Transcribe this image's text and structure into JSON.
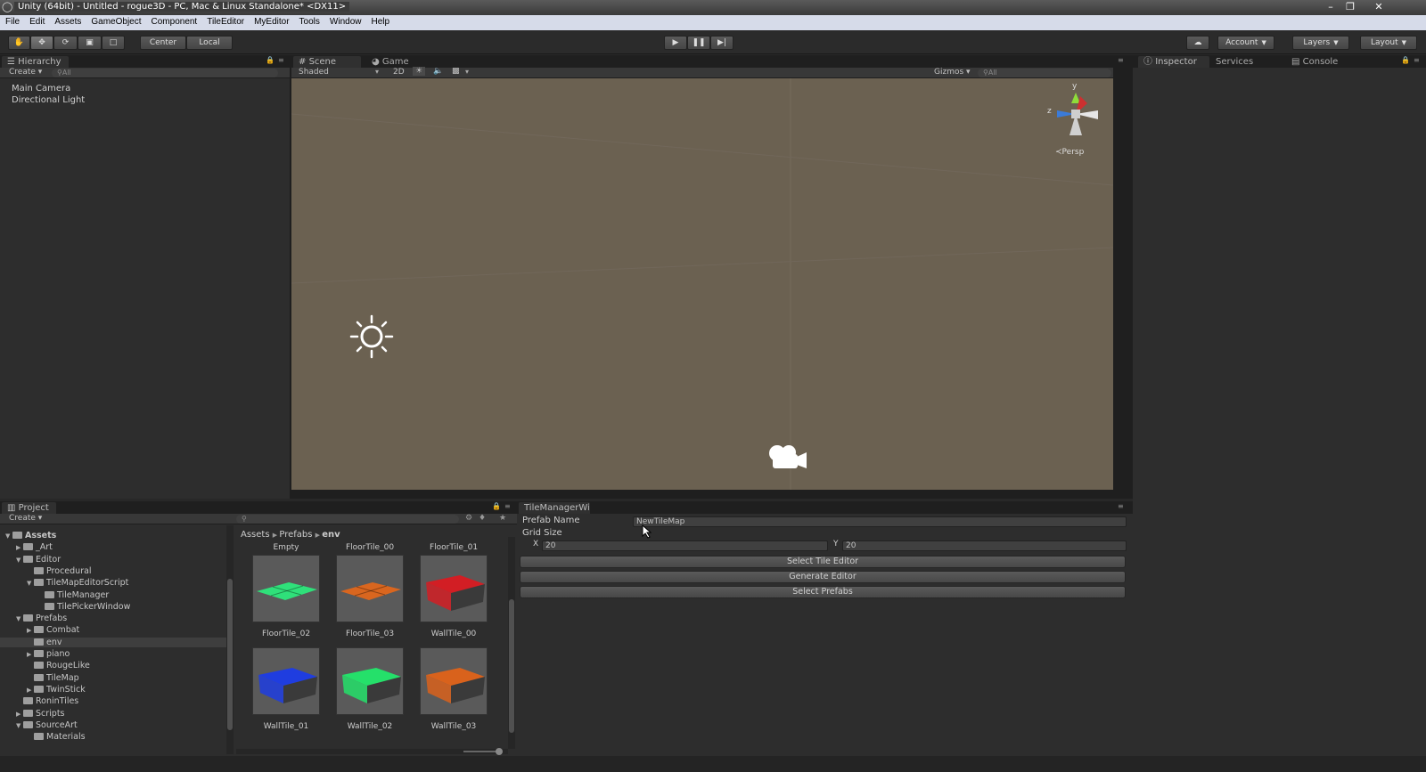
{
  "titlebar": {
    "title": "Unity (64bit) - Untitled - rogue3D - PC, Mac & Linux Standalone* <DX11>",
    "minimize": "–",
    "restore": "❐",
    "close": "✕"
  },
  "menubar": [
    "File",
    "Edit",
    "Assets",
    "GameObject",
    "Component",
    "TileEditor",
    "MyEditor",
    "Tools",
    "Window",
    "Help"
  ],
  "toolbar": {
    "pivot_center": "Center",
    "pivot_local": "Local",
    "account": "Account",
    "layers": "Layers",
    "layout": "Layout"
  },
  "hierarchy": {
    "tab": "Hierarchy",
    "create": "Create",
    "search_placeholder": "All",
    "items": [
      "Main Camera",
      "Directional Light"
    ]
  },
  "scene": {
    "tab_scene": "Scene",
    "tab_game": "Game",
    "shading": "Shaded",
    "mode_2d": "2D",
    "gizmos": "Gizmos",
    "search_placeholder": "All",
    "persp": "Persp",
    "axis_y": "y",
    "axis_z": "z"
  },
  "inspector": {
    "tab_inspector": "Inspector",
    "tab_services": "Services",
    "tab_console": "Console"
  },
  "project": {
    "tab": "Project",
    "create": "Create",
    "breadcrumb": [
      "Assets",
      "Prefabs",
      "env"
    ],
    "tree": [
      {
        "label": "Assets",
        "depth": 0,
        "open": true,
        "bold": true
      },
      {
        "label": "_Art",
        "depth": 1,
        "open": false
      },
      {
        "label": "Editor",
        "depth": 1,
        "open": true
      },
      {
        "label": "Procedural",
        "depth": 2,
        "open": null
      },
      {
        "label": "TileMapEditorScript",
        "depth": 2,
        "open": true
      },
      {
        "label": "TileManager",
        "depth": 3,
        "open": null
      },
      {
        "label": "TilePickerWindow",
        "depth": 3,
        "open": null
      },
      {
        "label": "Prefabs",
        "depth": 1,
        "open": true
      },
      {
        "label": "Combat",
        "depth": 2,
        "open": false
      },
      {
        "label": "env",
        "depth": 2,
        "open": null,
        "selected": true
      },
      {
        "label": "piano",
        "depth": 2,
        "open": false
      },
      {
        "label": "RougeLike",
        "depth": 2,
        "open": null
      },
      {
        "label": "TileMap",
        "depth": 2,
        "open": null
      },
      {
        "label": "TwinStick",
        "depth": 2,
        "open": false
      },
      {
        "label": "RoninTiles",
        "depth": 1,
        "open": null
      },
      {
        "label": "Scripts",
        "depth": 1,
        "open": false
      },
      {
        "label": "SourceArt",
        "depth": 1,
        "open": true
      },
      {
        "label": "Materials",
        "depth": 2,
        "open": null
      }
    ],
    "top_labels": [
      "Empty",
      "FloorTile_00",
      "FloorTile_01"
    ],
    "assets": [
      {
        "name": "FloorTile_02",
        "color": "#2fe07a",
        "kind": "floor"
      },
      {
        "name": "FloorTile_03",
        "color": "#d9661f",
        "kind": "floor"
      },
      {
        "name": "WallTile_00",
        "color": "#d21e24",
        "kind": "wall"
      },
      {
        "name": "WallTile_01",
        "color": "#1f3de0",
        "kind": "wall"
      },
      {
        "name": "WallTile_02",
        "color": "#25e06a",
        "kind": "wall"
      },
      {
        "name": "WallTile_03",
        "color": "#d9621c",
        "kind": "wall"
      }
    ]
  },
  "tilemanager": {
    "tab": "TileManagerWi",
    "prefab_name_label": "Prefab Name",
    "prefab_name_value": "NewTileMap",
    "grid_size_label": "Grid Size",
    "x_label": "X",
    "x_value": "20",
    "y_label": "Y",
    "y_value": "20",
    "buttons": [
      "Select Tile Editor",
      "Generate Editor",
      "Select Prefabs"
    ]
  },
  "colors": {
    "scene_bg": "#6b6151",
    "panel_bg": "#2d2d2d"
  }
}
